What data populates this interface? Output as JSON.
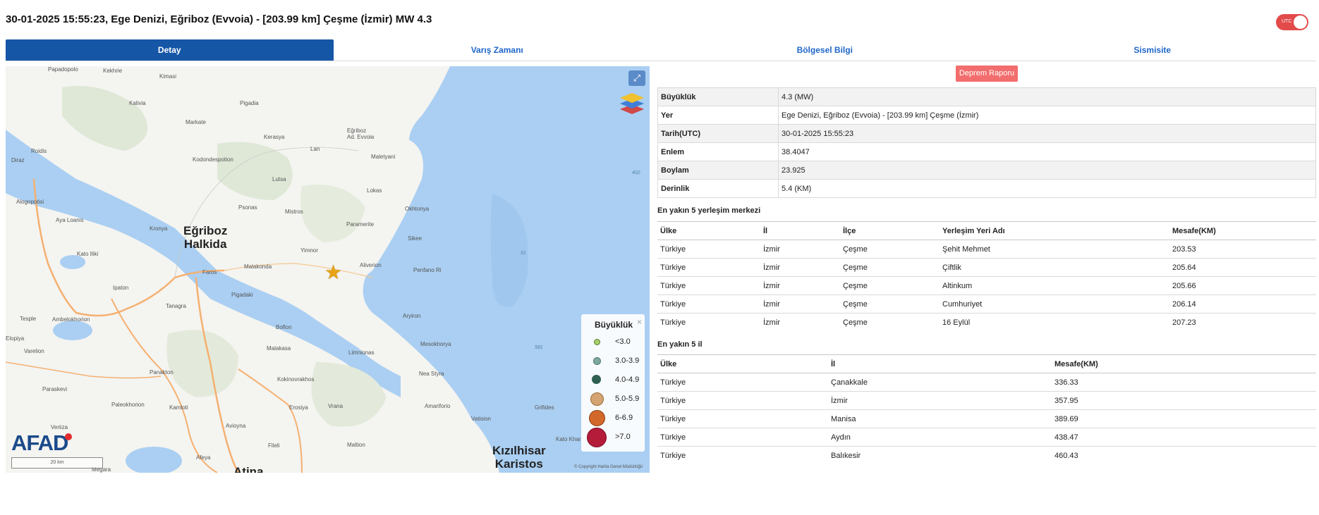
{
  "header": {
    "title": "30-01-2025 15:55:23, Ege Denizi, Eğriboz (Evvoia) - [203.99 km] Çeşme (İzmir) MW 4.3",
    "utc_label": "UTC"
  },
  "tabs": [
    "Detay",
    "Varış Zamanı",
    "Bölgesel Bilgi",
    "Sismisite"
  ],
  "map": {
    "big_labels": {
      "halkida": "Eğriboz\nHalkida",
      "karistos": "Kızılhisar\nKaristos",
      "atina": "Atina"
    },
    "places": [
      "Papadopolo",
      "Kekhrie",
      "Kimasi",
      "Kalivia",
      "Pigadia",
      "Markate",
      "Eğriboz\nAd. Evvoia",
      "Kerasya",
      "Kodondespotion",
      "Lan",
      "Maletyani",
      "Diraz",
      "Roidis",
      "Lutsa",
      "Lokas",
      "Alogopotisi",
      "Psonas",
      "Mistros",
      "Okhtonya",
      "Aya Loanis",
      "Kronya",
      "Paramerite",
      "Sikee",
      "Kato Iliki",
      "Yimnor",
      "Faros",
      "Malakonda",
      "Aliverion",
      "Penfano Ri",
      "Ipaton",
      "Pigadaki",
      "Tanagra",
      "Tesple",
      "Ambelokhorion",
      "Aryiron",
      "Elopiya",
      "Boflon",
      "Mesokhorya",
      "Varelion",
      "Malakasa",
      "Limnionas",
      "Panakton",
      "Nea Styra",
      "Kokinovrakhos",
      "Paraskevi",
      "Paleokhorion",
      "Kamloti",
      "Erosiya",
      "Vrana",
      "Amariforio",
      "Vatision",
      "Grifides",
      "Veriiza",
      "Kato Khar",
      "Avioyna",
      "Maltion",
      "Fileli",
      "Megara",
      "Afeya"
    ],
    "sea_labels": [
      "402",
      "51",
      "581"
    ],
    "legend": {
      "title": "Büyüklük",
      "close": "×",
      "items": [
        {
          "label": "<3.0",
          "color": "#a8d06a",
          "size": 7
        },
        {
          "label": "3.0-3.9",
          "color": "#7fa8a0",
          "size": 9
        },
        {
          "label": "4.0-4.9",
          "color": "#2f5f50",
          "size": 13
        },
        {
          "label": "5.0-5.9",
          "color": "#d4a572",
          "size": 17
        },
        {
          "label": "6-6.9",
          "color": "#d2692a",
          "size": 21
        },
        {
          "label": ">7.0",
          "color": "#b51c3a",
          "size": 26
        }
      ]
    },
    "logo": "AFAD",
    "scale": "20 km",
    "copyright": "© Copyright Harita Genel Müdürlüğü"
  },
  "report_button": "Deprem Raporu",
  "details": [
    {
      "key": "Büyüklük",
      "value": "4.3 (MW)"
    },
    {
      "key": "Yer",
      "value": "Ege Denizi, Eğriboz (Evvoia) - [203.99 km] Çeşme (İzmir)"
    },
    {
      "key": "Tarih(UTC)",
      "value": "30-01-2025 15:55:23"
    },
    {
      "key": "Enlem",
      "value": "38.4047"
    },
    {
      "key": "Boylam",
      "value": "23.925"
    },
    {
      "key": "Derinlik",
      "value": "5.4 (KM)"
    }
  ],
  "nearest_settlements": {
    "title": "En yakın 5 yerleşim merkezi",
    "headers": [
      "Ülke",
      "İl",
      "İlçe",
      "Yerleşim Yeri Adı",
      "Mesafe(KM)"
    ],
    "rows": [
      [
        "Türkiye",
        "İzmir",
        "Çeşme",
        "Şehit Mehmet",
        "203.53"
      ],
      [
        "Türkiye",
        "İzmir",
        "Çeşme",
        "Çiftlik",
        "205.64"
      ],
      [
        "Türkiye",
        "İzmir",
        "Çeşme",
        "Altinkum",
        "205.66"
      ],
      [
        "Türkiye",
        "İzmir",
        "Çeşme",
        "Cumhuriyet",
        "206.14"
      ],
      [
        "Türkiye",
        "İzmir",
        "Çeşme",
        "16 Eylül",
        "207.23"
      ]
    ]
  },
  "nearest_provinces": {
    "title": "En yakın 5 il",
    "headers": [
      "Ülke",
      "İl",
      "Mesafe(KM)"
    ],
    "rows": [
      [
        "Türkiye",
        "Çanakkale",
        "336.33"
      ],
      [
        "Türkiye",
        "İzmir",
        "357.95"
      ],
      [
        "Türkiye",
        "Manisa",
        "389.69"
      ],
      [
        "Türkiye",
        "Aydın",
        "438.47"
      ],
      [
        "Türkiye",
        "Balıkesir",
        "460.43"
      ]
    ]
  }
}
